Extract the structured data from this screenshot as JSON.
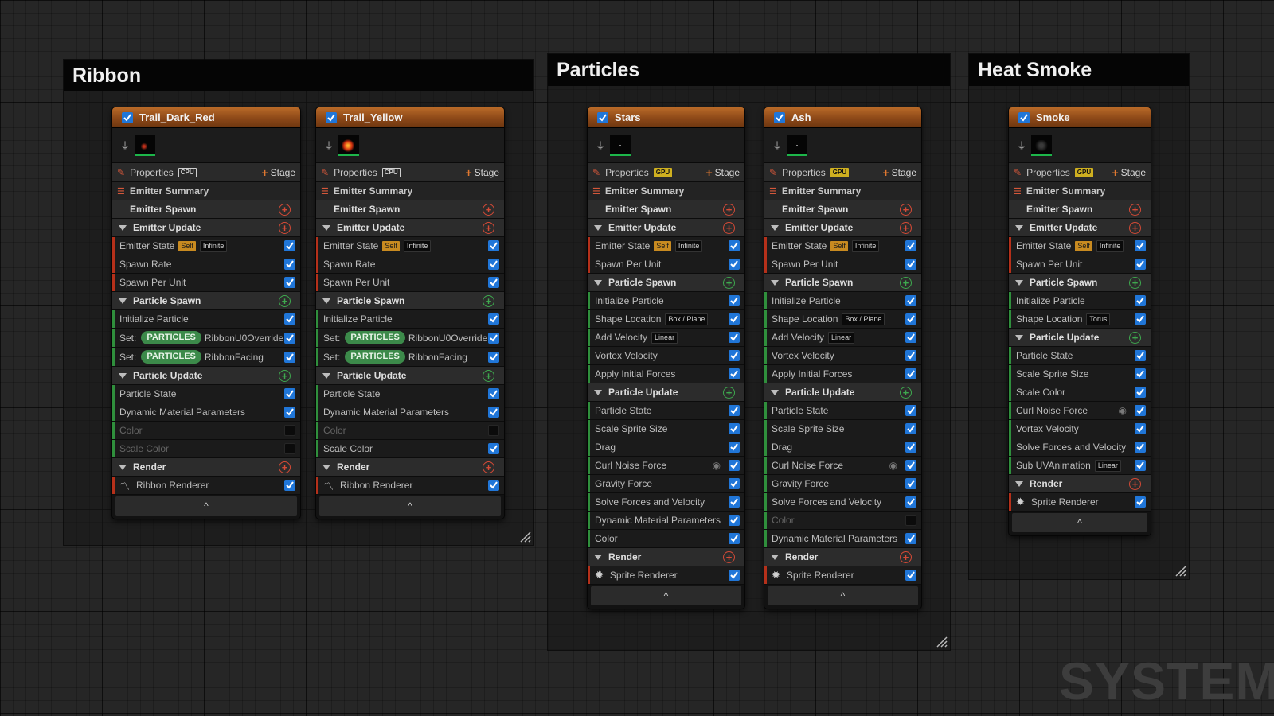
{
  "groups": {
    "ribbon": "Ribbon",
    "particles": "Particles",
    "heat_smoke": "Heat Smoke"
  },
  "common": {
    "properties": "Properties",
    "stage": "Stage",
    "emitter_summary": "Emitter Summary",
    "emitter_spawn": "Emitter Spawn",
    "emitter_update": "Emitter Update",
    "particle_spawn": "Particle Spawn",
    "particle_update": "Particle Update",
    "render": "Render",
    "cpu": "CPU",
    "gpu": "GPU",
    "self": "Self",
    "infinite": "Infinite",
    "linear": "Linear",
    "box_plane": "Box / Plane",
    "torus": "Torus",
    "set": "Set:",
    "particles_tag": "PARTICLES",
    "collapse": "^"
  },
  "emitters": {
    "trail_dark_red": {
      "name": "Trail_Dark_Red",
      "rows": [
        "Emitter State",
        "Spawn Rate",
        "Spawn Per Unit",
        "Initialize Particle",
        "RibbonU0Override",
        "RibbonFacing",
        "Particle State",
        "Dynamic Material Parameters",
        "Color",
        "Scale Color",
        "Ribbon Renderer"
      ]
    },
    "trail_yellow": {
      "name": "Trail_Yellow",
      "rows": [
        "Emitter State",
        "Spawn Rate",
        "Spawn Per Unit",
        "Initialize Particle",
        "RibbonU0Override",
        "RibbonFacing",
        "Particle State",
        "Dynamic Material Parameters",
        "Color",
        "Scale Color",
        "Ribbon Renderer"
      ]
    },
    "stars": {
      "name": "Stars",
      "rows": [
        "Emitter State",
        "Spawn Per Unit",
        "Initialize Particle",
        "Shape Location",
        "Add Velocity",
        "Vortex Velocity",
        "Apply Initial Forces",
        "Particle State",
        "Scale Sprite Size",
        "Drag",
        "Curl Noise Force",
        "Gravity Force",
        "Solve Forces and Velocity",
        "Dynamic Material Parameters",
        "Color",
        "Sprite Renderer"
      ]
    },
    "ash": {
      "name": "Ash",
      "rows": [
        "Emitter State",
        "Spawn Per Unit",
        "Initialize Particle",
        "Shape Location",
        "Add Velocity",
        "Vortex Velocity",
        "Apply Initial Forces",
        "Particle State",
        "Scale Sprite Size",
        "Drag",
        "Curl Noise Force",
        "Gravity Force",
        "Solve Forces and Velocity",
        "Color",
        "Dynamic Material Parameters",
        "Sprite Renderer"
      ]
    },
    "smoke": {
      "name": "Smoke",
      "rows": [
        "Emitter State",
        "Spawn Per Unit",
        "Initialize Particle",
        "Shape Location",
        "Particle State",
        "Scale Sprite Size",
        "Scale Color",
        "Curl Noise Force",
        "Vortex Velocity",
        "Solve Forces and Velocity",
        "Sub UVAnimation",
        "Sprite Renderer"
      ]
    }
  },
  "watermark": "SYSTEM",
  "colors": {
    "accent": "#2076d8",
    "header": "#b96a28",
    "add_red": "#d54a36",
    "add_green": "#3ea84e",
    "gpu_badge": "#cfb020",
    "self_badge": "#c88a20",
    "particles_pill": "#3c8a4a"
  }
}
